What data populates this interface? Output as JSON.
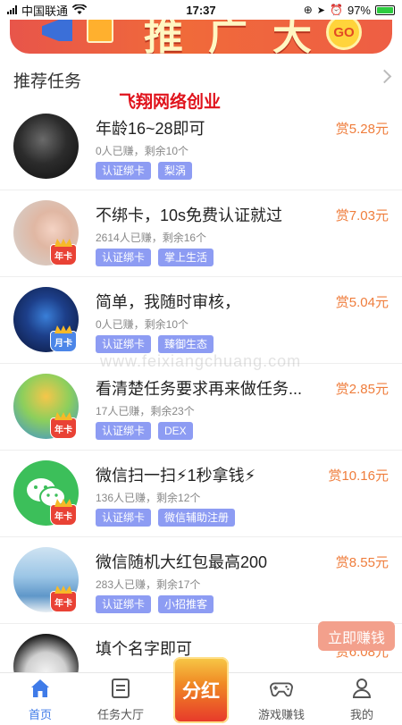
{
  "status_bar": {
    "carrier": "中国联通",
    "time": "17:37",
    "battery": "97%"
  },
  "banner": {
    "text": "推广大奖",
    "button": "GO"
  },
  "section": {
    "title": "推荐任务"
  },
  "watermarks": {
    "red_text": "飞翔网络创业",
    "faint_text": "www.feixiangchuang.com"
  },
  "tasks": [
    {
      "title": "年龄16~28即可",
      "meta": "0人已赚，剩余10个",
      "tags": [
        "认证绑卡",
        "梨涡"
      ],
      "reward": "赏5.28元",
      "badge": ""
    },
    {
      "title": "不绑卡，10s免费认证就过",
      "meta": "2614人已赚，剩余16个",
      "tags": [
        "认证绑卡",
        "掌上生活"
      ],
      "reward": "赏7.03元",
      "badge": "年卡"
    },
    {
      "title": "简单，我随时审核，",
      "meta": "0人已赚，剩余10个",
      "tags": [
        "认证绑卡",
        "臻御生态"
      ],
      "reward": "赏5.04元",
      "badge": "月卡"
    },
    {
      "title": "看清楚任务要求再来做任务...",
      "meta": "17人已赚，剩余23个",
      "tags": [
        "认证绑卡",
        "DEX"
      ],
      "reward": "赏2.85元",
      "badge": "年卡"
    },
    {
      "title": "微信扫一扫⚡1秒拿钱⚡",
      "meta": "136人已赚，剩余12个",
      "tags": [
        "认证绑卡",
        "微信辅助注册"
      ],
      "reward": "赏10.16元",
      "badge": "年卡"
    },
    {
      "title": "微信随机大红包最高200",
      "meta": "283人已赚，剩余17个",
      "tags": [
        "认证绑卡",
        "小招推客"
      ],
      "reward": "赏8.55元",
      "badge": "年卡"
    },
    {
      "title": "填个名字即可",
      "meta": "",
      "tags": [],
      "reward": "赏6.08元",
      "badge": ""
    }
  ],
  "float_button": "立即赚钱",
  "tab_bar": {
    "home": "首页",
    "hall": "任务大厅",
    "center": "分红",
    "games": "游戏赚钱",
    "mine": "我的"
  },
  "colors": {
    "accent": "#3f7be8",
    "reward": "#ef7d3c",
    "tag": "#8d9cf3"
  }
}
